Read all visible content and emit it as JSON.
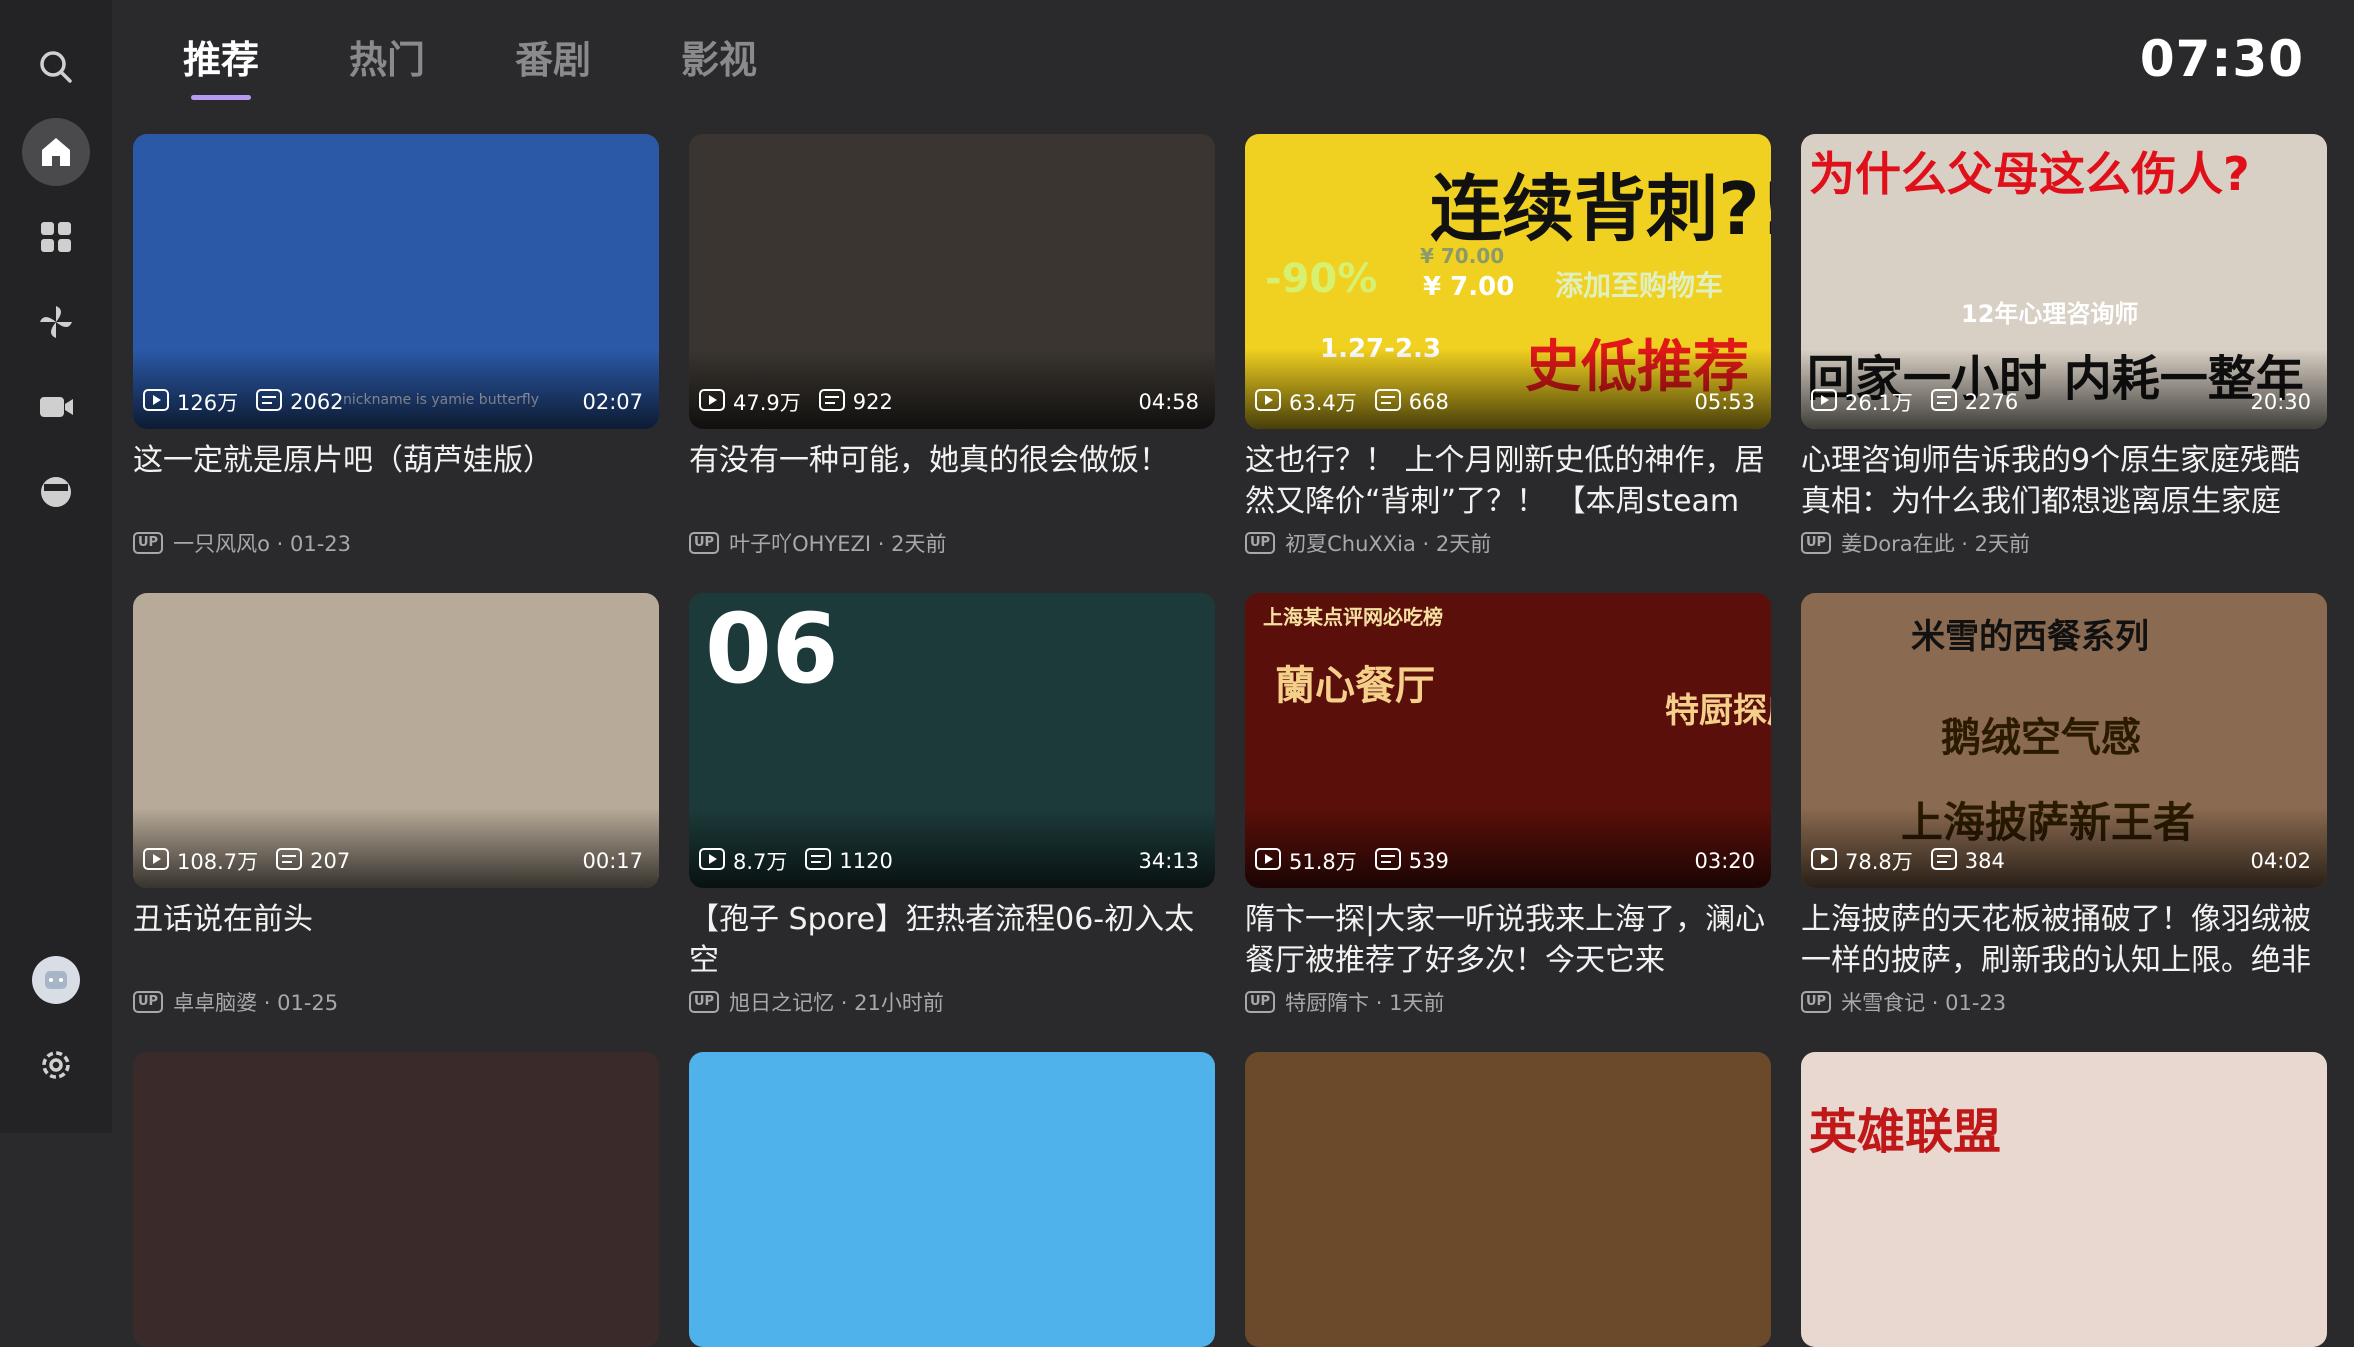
{
  "header": {
    "tabs": [
      {
        "label": "推荐"
      },
      {
        "label": "热门"
      },
      {
        "label": "番剧"
      },
      {
        "label": "影视"
      }
    ],
    "clock": "07:30"
  },
  "sidebar": {
    "items": [
      {
        "icon": "search-icon"
      },
      {
        "icon": "home-icon"
      },
      {
        "icon": "grid-icon"
      },
      {
        "icon": "pinwheel-icon"
      },
      {
        "icon": "video-camera-icon"
      },
      {
        "icon": "drama-icon"
      },
      {
        "icon": "avatar"
      },
      {
        "icon": "gear-icon"
      }
    ]
  },
  "videos": [
    {
      "title": "这一定就是原片吧（葫芦娃版）",
      "views": "126万",
      "danmaku": "2062",
      "duration": "02:07",
      "up_tag": "UP",
      "author": "一只风风o · 01-23",
      "thumb_bg": "#2b59a8",
      "thumb_overlay": "nickname is yamie butterfly"
    },
    {
      "title": "有没有一种可能，她真的很会做饭！",
      "views": "47.9万",
      "danmaku": "922",
      "duration": "04:58",
      "up_tag": "UP",
      "author": "叶子吖OHYEZI · 2天前",
      "thumb_bg": "#3a3530"
    },
    {
      "title": "这也行？！ 上个月刚新史低的神作，居然又降价“背刺”了？！ 【本周steam",
      "views": "63.4万",
      "danmaku": "668",
      "duration": "05:53",
      "up_tag": "UP",
      "author": "初夏ChuXXia · 2天前",
      "thumb_bg": "#f0d020",
      "thumb_texts": [
        "连续背刺?!",
        "-90%",
        "¥ 70.00",
        "¥ 7.00",
        "添加至购物车",
        "1.27-2.3",
        "史低推荐"
      ]
    },
    {
      "title": "心理咨询师告诉我的9个原生家庭残酷真相：为什么我们都想逃离原生家庭",
      "views": "26.1万",
      "danmaku": "2276",
      "duration": "20:30",
      "up_tag": "UP",
      "author": "姜Dora在此 · 2天前",
      "thumb_bg": "#d8d0c4",
      "thumb_texts": [
        "为什么父母这么伤人?",
        "12年心理咨询师",
        "回家一小时 内耗一整年"
      ]
    },
    {
      "title": "丑话说在前头",
      "views": "108.7万",
      "danmaku": "207",
      "duration": "00:17",
      "up_tag": "UP",
      "author": "卓卓脑婆 · 01-25",
      "thumb_bg": "#b8aa98"
    },
    {
      "title": "【孢子 Spore】狂热者流程06-初入太空",
      "views": "8.7万",
      "danmaku": "1120",
      "duration": "34:13",
      "up_tag": "UP",
      "author": "旭日之记忆 · 21小时前",
      "thumb_bg": "#1d3a3a",
      "thumb_texts": [
        "06"
      ]
    },
    {
      "title": "隋卞一探|大家一听说我来上海了，澜心餐厅被推荐了好多次！今天它来",
      "views": "51.8万",
      "danmaku": "539",
      "duration": "03:20",
      "up_tag": "UP",
      "author": "特厨隋卞 · 1天前",
      "thumb_bg": "#5a0f0a",
      "thumb_texts": [
        "上海某点评网必吃榜",
        "蘭心餐厅",
        "特厨探店"
      ]
    },
    {
      "title": "上海披萨的天花板被捅破了！像羽绒被一样的披萨，刷新我的认知上限。绝非",
      "views": "78.8万",
      "danmaku": "384",
      "duration": "04:02",
      "up_tag": "UP",
      "author": "米雪食记 · 01-23",
      "thumb_bg": "#8a6a50",
      "thumb_texts": [
        "米雪的西餐系列",
        "鹅绒空气感",
        "上海披萨新王者"
      ]
    }
  ],
  "partial_row": [
    {
      "thumb_bg": "#3a2a2a"
    },
    {
      "thumb_bg": "#4fb2ea"
    },
    {
      "thumb_bg": "#6a4a2a"
    },
    {
      "thumb_bg": "#e8d8d0",
      "thumb_text": "英雄联盟"
    }
  ]
}
